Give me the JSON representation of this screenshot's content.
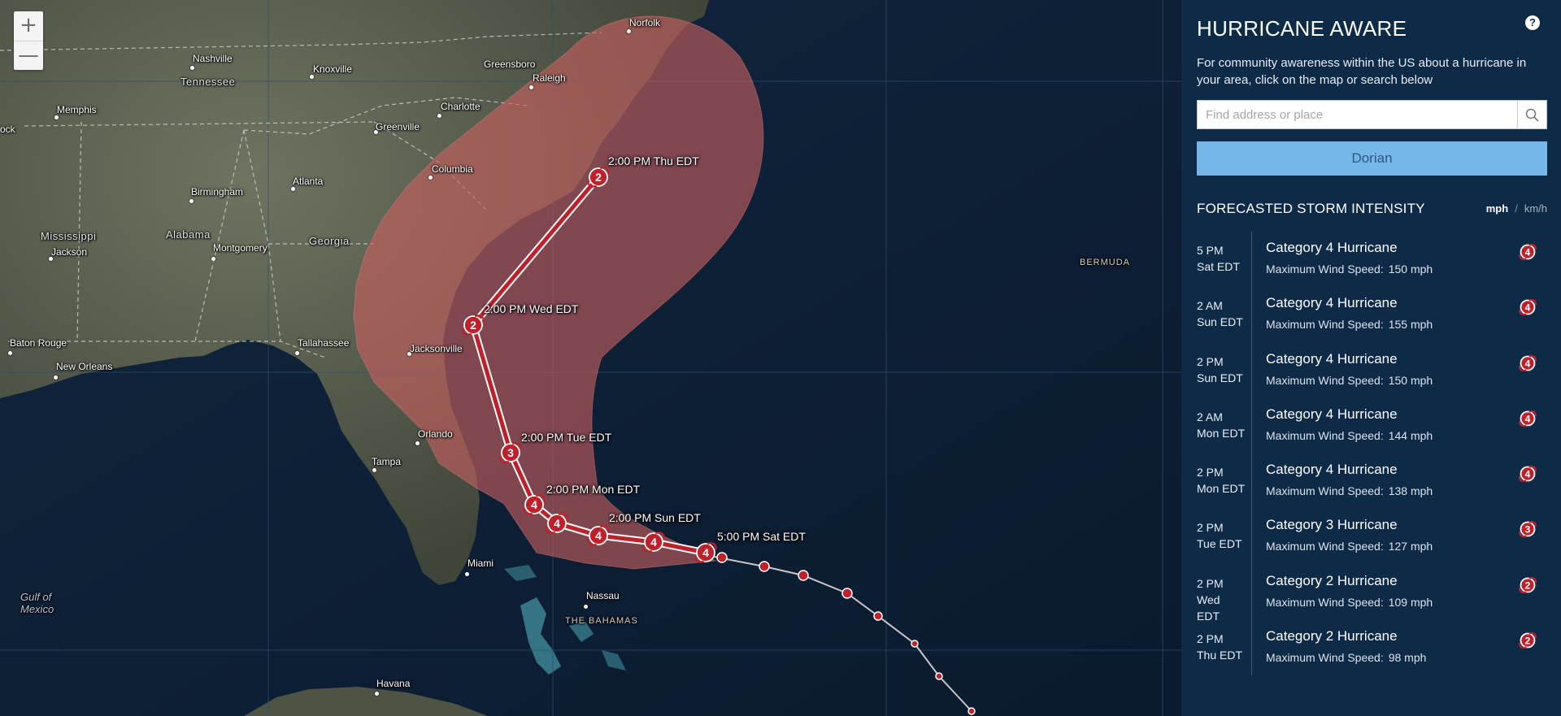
{
  "map": {
    "zoom_in": "+",
    "zoom_out": "—",
    "places": [
      {
        "id": "norfolk",
        "label": "Norfolk"
      },
      {
        "id": "nashville",
        "label": "Nashville"
      },
      {
        "id": "knoxville",
        "label": "Knoxville"
      },
      {
        "id": "greensboro",
        "label": "Greensboro"
      },
      {
        "id": "raleigh",
        "label": "Raleigh"
      },
      {
        "id": "tennessee",
        "label": "Tennessee"
      },
      {
        "id": "memphis",
        "label": "Memphis"
      },
      {
        "id": "charlotte",
        "label": "Charlotte"
      },
      {
        "id": "greenville",
        "label": "Greenville"
      },
      {
        "id": "columbia",
        "label": "Columbia"
      },
      {
        "id": "atlanta",
        "label": "Atlanta"
      },
      {
        "id": "birmingham",
        "label": "Birmingham"
      },
      {
        "id": "mississippi",
        "label": "Mississippi"
      },
      {
        "id": "alabama",
        "label": "Alabama"
      },
      {
        "id": "georgia",
        "label": "Georgia"
      },
      {
        "id": "jackson",
        "label": "Jackson"
      },
      {
        "id": "montgomery",
        "label": "Montgomery"
      },
      {
        "id": "baton_rouge",
        "label": "Baton Rouge"
      },
      {
        "id": "tallahassee",
        "label": "Tallahassee"
      },
      {
        "id": "jacksonville",
        "label": "Jacksonville"
      },
      {
        "id": "new_orleans",
        "label": "New Orleans"
      },
      {
        "id": "orlando",
        "label": "Orlando"
      },
      {
        "id": "tampa",
        "label": "Tampa"
      },
      {
        "id": "miami",
        "label": "Miami"
      },
      {
        "id": "nassau",
        "label": "Nassau"
      },
      {
        "id": "bahamas",
        "label": "THE BAHAMAS"
      },
      {
        "id": "havana",
        "label": "Havana"
      },
      {
        "id": "bermuda",
        "label": "BERMUDA"
      },
      {
        "id": "gulf",
        "label": "Gulf of Mexico"
      },
      {
        "id": "ock",
        "label": "ock"
      }
    ],
    "track_labels": {
      "thu": "2:00 PM Thu EDT",
      "wed": "2:00 PM Wed EDT",
      "tue": "2:00 PM Tue EDT",
      "mon": "2:00 PM Mon EDT",
      "sun": "2:00 PM Sun EDT",
      "sat": "5:00 PM Sat EDT"
    },
    "track_categories": [
      "2",
      "2",
      "3",
      "4",
      "4",
      "4",
      "4",
      "4"
    ],
    "colors": {
      "cone": "#c86060",
      "track": "#c0202a",
      "past_track": "#c8c8c8"
    }
  },
  "panel": {
    "title": "HURRICANE AWARE",
    "help": "?",
    "intro": "For community awareness within the US about a hurricane in your area, click on the map or search below",
    "search_placeholder": "Find address or place",
    "storm_button": "Dorian",
    "forecast_heading": "FORECASTED STORM INTENSITY",
    "units": {
      "active": "mph",
      "separator": "/",
      "inactive": "km/h"
    },
    "wind_label": "Maximum Wind Speed:",
    "forecast": [
      {
        "time": "5 PM",
        "day": "Sat EDT",
        "category": "Category 4 Hurricane",
        "badge": "4",
        "wind": "150 mph"
      },
      {
        "time": "2 AM",
        "day": "Sun EDT",
        "category": "Category 4 Hurricane",
        "badge": "4",
        "wind": "155 mph"
      },
      {
        "time": "2 PM",
        "day": "Sun EDT",
        "category": "Category 4 Hurricane",
        "badge": "4",
        "wind": "150 mph"
      },
      {
        "time": "2 AM",
        "day": "Mon EDT",
        "category": "Category 4 Hurricane",
        "badge": "4",
        "wind": "144 mph"
      },
      {
        "time": "2 PM",
        "day": "Mon EDT",
        "category": "Category 4 Hurricane",
        "badge": "4",
        "wind": "138 mph"
      },
      {
        "time": "2 PM",
        "day": "Tue EDT",
        "category": "Category 3 Hurricane",
        "badge": "3",
        "wind": "127 mph"
      },
      {
        "time": "2 PM",
        "day": "Wed EDT",
        "category": "Category 2 Hurricane",
        "badge": "2",
        "wind": "109 mph"
      },
      {
        "time": "2 PM",
        "day": "Thu EDT",
        "category": "Category 2 Hurricane",
        "badge": "2",
        "wind": "98 mph"
      }
    ],
    "colors": {
      "background": "#0d2a47",
      "button": "#75b7e8",
      "badge": "#c0202a"
    }
  }
}
